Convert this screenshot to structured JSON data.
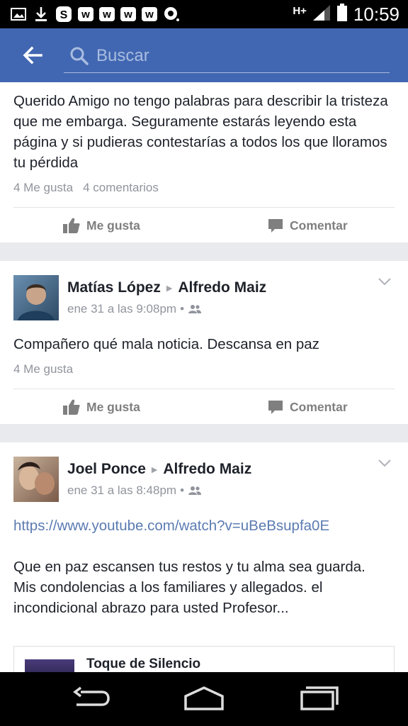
{
  "status_bar": {
    "network": "H+",
    "time": "10:59",
    "w_badges": [
      "w",
      "w",
      "w",
      "w"
    ]
  },
  "search": {
    "placeholder": "Buscar"
  },
  "posts": [
    {
      "text": "Querido Amigo no tengo palabras para describir la tristeza que me embarga. Seguramente estarás leyendo esta página y si pudieras contestarías a todos los que lloramos tu pérdida",
      "likes": "4 Me gusta",
      "comments": "4 comentarios",
      "like_label": "Me gusta",
      "comment_label": "Comentar"
    },
    {
      "author": "Matías López",
      "target": "Alfredo Maiz",
      "date": "ene 31 a las 9:08pm",
      "text": "Compañero qué mala noticia. Descansa en paz",
      "likes": "4 Me gusta",
      "like_label": "Me gusta",
      "comment_label": "Comentar"
    },
    {
      "author": "Joel Ponce",
      "target": "Alfredo Maiz",
      "date": "ene 31 a las 8:48pm",
      "link": "https://www.youtube.com/watch?v=uBeBsupfa0E",
      "text": "Que en paz escansen tus restos y tu alma sea guarda. Mis condolencias a los familiares y allegados. el incondicional abrazo para usted Profesor...",
      "attachment_title": "Toque de Silencio"
    }
  ],
  "colors": {
    "header": "#4267b2",
    "background": "#e9eaed",
    "link": "#5b7bb2",
    "action": "#7f7f7f"
  }
}
